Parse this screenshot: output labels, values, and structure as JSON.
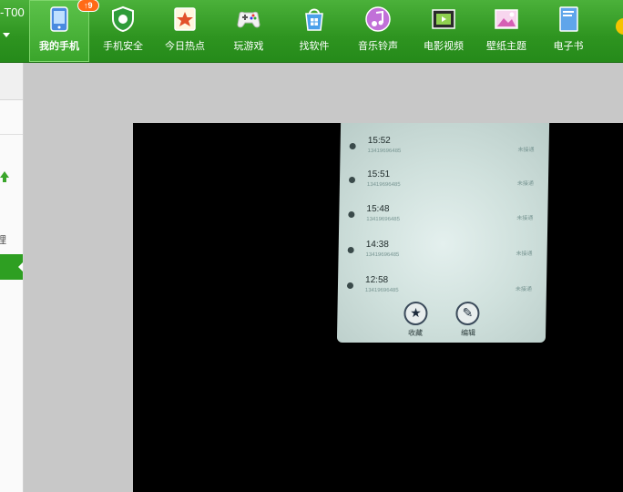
{
  "device": {
    "name": "-T00"
  },
  "nav": {
    "items": [
      {
        "label": "我的手机",
        "icon": "phone-icon",
        "badge": "9",
        "active": true
      },
      {
        "label": "手机安全",
        "icon": "shield-icon"
      },
      {
        "label": "今日热点",
        "icon": "star-news-icon"
      },
      {
        "label": "玩游戏",
        "icon": "gamepad-icon"
      },
      {
        "label": "找软件",
        "icon": "software-icon"
      },
      {
        "label": "音乐铃声",
        "icon": "music-icon"
      },
      {
        "label": "电影视频",
        "icon": "film-icon"
      },
      {
        "label": "壁纸主题",
        "icon": "wallpaper-icon"
      },
      {
        "label": "电子书",
        "icon": "ebook-icon"
      }
    ]
  },
  "sidebar": {
    "char": "理"
  },
  "photo": {
    "calls": [
      {
        "time": "15:52",
        "number": "13419696485",
        "status": "未接通"
      },
      {
        "time": "15:51",
        "number": "13419696485",
        "status": "未接通"
      },
      {
        "time": "15:48",
        "number": "13419696485",
        "status": "未接通"
      },
      {
        "time": "14:38",
        "number": "13419696485",
        "status": "未接通"
      },
      {
        "time": "12:58",
        "number": "13419696485",
        "status": "未接通"
      }
    ],
    "favorite_label": "收藏",
    "edit_label": "编辑"
  },
  "colors": {
    "accent": "#2e9420",
    "viewer_bg": "#000000",
    "panel_bg": "#c8c8c8"
  }
}
